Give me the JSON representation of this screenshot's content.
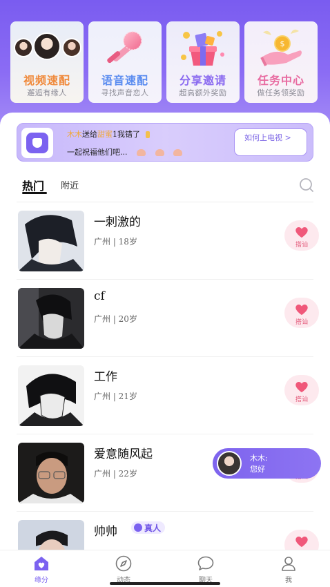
{
  "features": [
    {
      "title": "视频速配",
      "subtitle": "邂逅有缘人",
      "icon": "avatar-cluster",
      "color": "#f08a3c"
    },
    {
      "title": "语音速配",
      "subtitle": "寻找声音恋人",
      "icon": "microphone-icon",
      "color": "#5a8cf0"
    },
    {
      "title": "分享邀请",
      "subtitle": "超高额外奖励",
      "icon": "gift-box-icon",
      "color": "#8a6af0"
    },
    {
      "title": "任务中心",
      "subtitle": "做任务领奖励",
      "icon": "coin-hand-icon",
      "color": "#e86aa0"
    }
  ],
  "notice": {
    "sender": "木木",
    "verb": "送给",
    "receiver": "甜蜜",
    "tail": "1我错了",
    "line2": "一起祝福他们吧...",
    "button_label": "如何上电视 >"
  },
  "tabs": {
    "hot": "热门",
    "near": "附近"
  },
  "users": [
    {
      "name": "一刺激的",
      "meta": "广州 | 18岁",
      "chat": "搭讪",
      "verified": false
    },
    {
      "name": "cf",
      "meta": "广州 | 20岁",
      "chat": "搭讪",
      "verified": false
    },
    {
      "name": "工作",
      "meta": "广州 | 21岁",
      "chat": "搭讪",
      "verified": false
    },
    {
      "name": "爱意随风起",
      "meta": "广州 | 22岁",
      "chat": "搭讪",
      "verified": false
    },
    {
      "name": "帅帅",
      "meta": "",
      "chat": "搭讪",
      "verified": true,
      "badge": "真人"
    }
  ],
  "floating_message": {
    "from": "木木:",
    "text": "您好"
  },
  "tabbar": [
    {
      "label": "缘分",
      "icon": "home-heart-icon",
      "active": true
    },
    {
      "label": "动态",
      "icon": "compass-icon",
      "active": false
    },
    {
      "label": "聊天",
      "icon": "chat-bubble-icon",
      "active": false
    },
    {
      "label": "我",
      "icon": "person-icon",
      "active": false
    }
  ],
  "colors": {
    "brand": "#7b62f0",
    "chat_pink": "#e35a7a"
  }
}
